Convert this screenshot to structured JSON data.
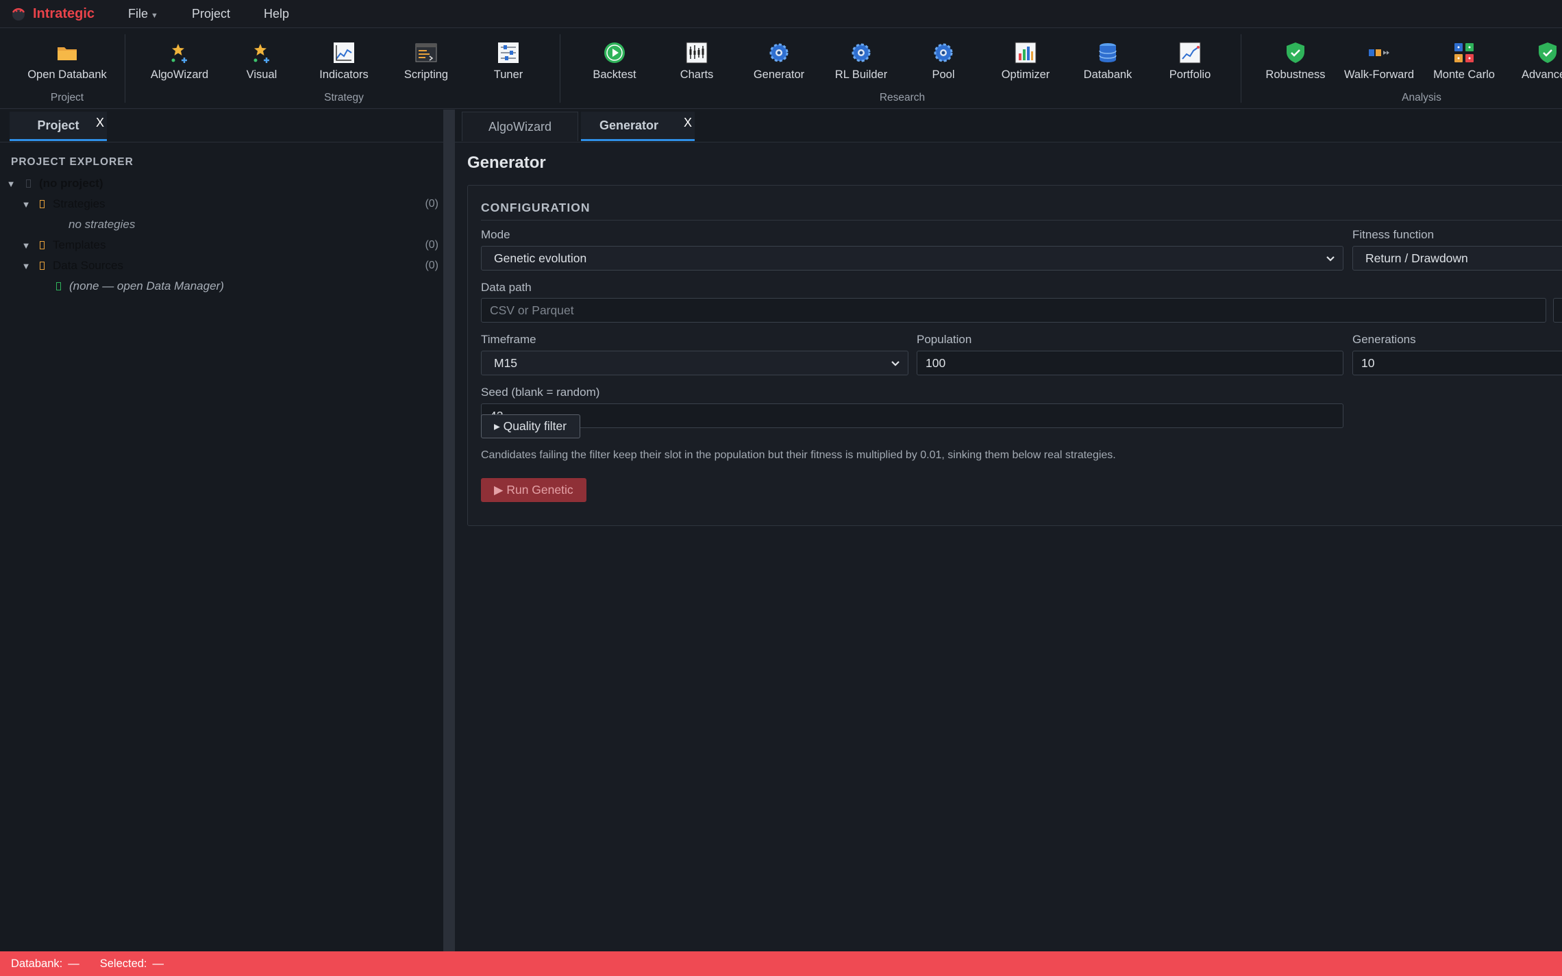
{
  "app": {
    "name": "Intrategic"
  },
  "menu": {
    "file": "File",
    "project": "Project",
    "help": "Help"
  },
  "toolbar": {
    "groups": {
      "project": "Project",
      "strategy": "Strategy",
      "research": "Research",
      "analysis": "Analysis"
    },
    "buttons": {
      "open_databank": "Open Databank",
      "algowizard": "AlgoWizard",
      "visual": "Visual",
      "indicators": "Indicators",
      "scripting": "Scripting",
      "tuner": "Tuner",
      "backtest": "Backtest",
      "charts": "Charts",
      "generator": "Generator",
      "rl_builder": "RL Builder",
      "pool": "Pool",
      "optimizer": "Optimizer",
      "databank": "Databank",
      "portfolio": "Portfolio",
      "robustness": "Robustness",
      "walk_forward": "Walk-Forward",
      "monte_carlo": "Monte Carlo",
      "advanced": "Advanced"
    }
  },
  "left_panel": {
    "tab": {
      "label": "Project",
      "close": "X"
    },
    "explorer_title": "PROJECT EXPLORER",
    "tree": {
      "root": "(no project)",
      "strategies": {
        "label": "Strategies",
        "count": "(0)",
        "empty": "no strategies"
      },
      "templates": {
        "label": "Templates",
        "count": "(0)"
      },
      "data_sources": {
        "label": "Data Sources",
        "count": "(0)",
        "empty": "(none — open Data Manager)"
      }
    }
  },
  "right_panel": {
    "tabs": {
      "algowizard": "AlgoWizard",
      "generator": "Generator",
      "close": "X"
    },
    "title": "Generator",
    "config": {
      "title": "CONFIGURATION",
      "mode": {
        "label": "Mode",
        "value": "Genetic evolution"
      },
      "fitness": {
        "label": "Fitness function",
        "value": "Return / Drawdown"
      },
      "data_path": {
        "label": "Data path",
        "placeholder": "CSV or Parquet"
      },
      "timeframe": {
        "label": "Timeframe",
        "value": "M15"
      },
      "population": {
        "label": "Population",
        "value": "100"
      },
      "generations": {
        "label": "Generations",
        "value": "10"
      },
      "seed": {
        "label": "Seed (blank = random)",
        "value": "42"
      },
      "quality_filter": "▸ Quality filter",
      "quality_desc": "Candidates failing the filter keep their slot in the population but their fitness is multiplied by 0.01, sinking them below real strategies.",
      "run": "▶ Run Genetic"
    }
  },
  "status": {
    "databank_label": "Databank:",
    "databank_value": "—",
    "selected_label": "Selected:",
    "selected_value": "—"
  },
  "colors": {
    "accent": "#2f8fe6",
    "brand": "#e9434a",
    "status_bar": "#ef4a53",
    "run_button": "#8f3037"
  }
}
